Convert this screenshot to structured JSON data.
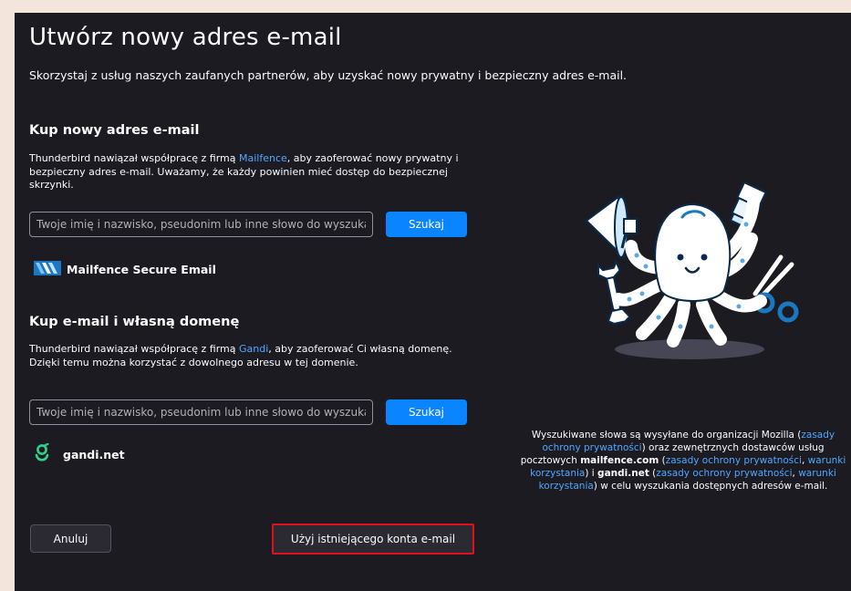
{
  "dialog": {
    "title": "Utwórz nowy adres e-mail",
    "subtitle": "Skorzystaj z usług naszych zaufanych partnerów, aby uzyskać nowy prywatny i bezpieczny adres e-mail."
  },
  "section1": {
    "title": "Kup nowy adres e-mail",
    "desc_before": "Thunderbird nawiązał współpracę z firmą ",
    "desc_link": "Mailfence",
    "desc_after": ", aby zaoferować nowy prywatny i bezpieczny adres e-mail. Uważamy, że każdy powinien mieć dostęp do bezpiecznej skrzynki.",
    "search_placeholder": "Twoje imię i nazwisko, pseudonim lub inne słowo do wyszukania",
    "search_button": "Szukaj",
    "provider_name": "Mailfence Secure Email",
    "provider_icon": "mailfence-logo-icon"
  },
  "section2": {
    "title": "Kup e-mail i własną domenę",
    "desc_before": "Thunderbird nawiązał współpracę z firmą ",
    "desc_link": "Gandi",
    "desc_after": ", aby zaoferować Ci własną domenę. Dzięki temu można korzystać z dowolnego adresu w tej domenie.",
    "search_placeholder": "Twoje imię i nazwisko, pseudonim lub inne słowo do wyszukania",
    "search_button": "Szukaj",
    "provider_name": "gandi.net",
    "provider_icon": "gandi-logo-icon"
  },
  "privacy": {
    "t1": "Wyszukiwane słowa są wysyłane do organizacji Mozilla (",
    "l1": "zasady ochrony prywatności",
    "t2": ") oraz zewnętrznych dostawców usług pocztowych ",
    "b1": "mailfence.com",
    "t3": " (",
    "l2": "zasady ochrony prywatności",
    "t4": ", ",
    "l3": "warunki korzystania",
    "t5": ") i ",
    "b2": "gandi.net",
    "t6": " (",
    "l4": "zasady ochrony prywatności",
    "t7": ", ",
    "l5": "warunki korzystania",
    "t8": ") w celu wyszukania dostępnych adresów e-mail."
  },
  "buttons": {
    "cancel": "Anuluj",
    "use_existing": "Użyj istniejącego konta e-mail"
  },
  "colors": {
    "background": "#1c1b22",
    "accent": "#0b84ff",
    "link": "#4fa7ff",
    "highlight": "#e0101e"
  }
}
